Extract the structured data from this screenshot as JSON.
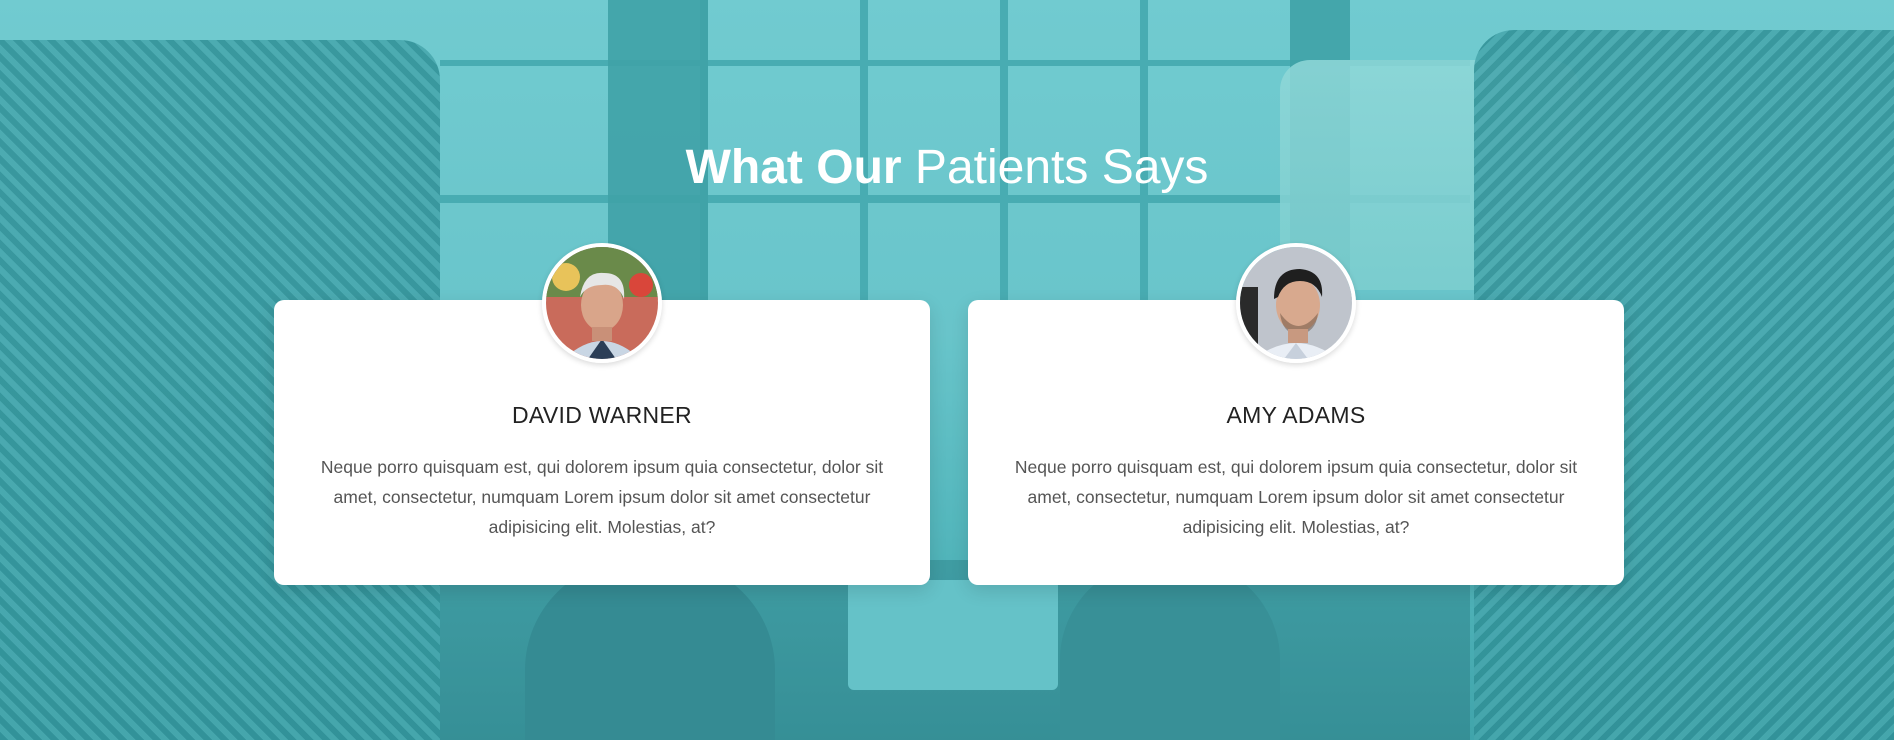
{
  "section": {
    "title_bold": "What Our",
    "title_light": "Patients Says"
  },
  "testimonials": [
    {
      "name": "DAVID WARNER",
      "text": "Neque porro quisquam est, qui dolorem ipsum quia consectetur, dolor sit amet, consectetur, numquam Lorem ipsum dolor sit amet consectetur adipisicing elit. Molestias, at?"
    },
    {
      "name": "AMY ADAMS",
      "text": "Neque porro quisquam est, qui dolorem ipsum quia consectetur, dolor sit amet, consectetur, numquam Lorem ipsum dolor sit amet consectetur adipisicing elit. Molestias, at?"
    }
  ],
  "colors": {
    "overlay": "#5bbdc2",
    "card_bg": "#ffffff",
    "title": "#ffffff"
  }
}
